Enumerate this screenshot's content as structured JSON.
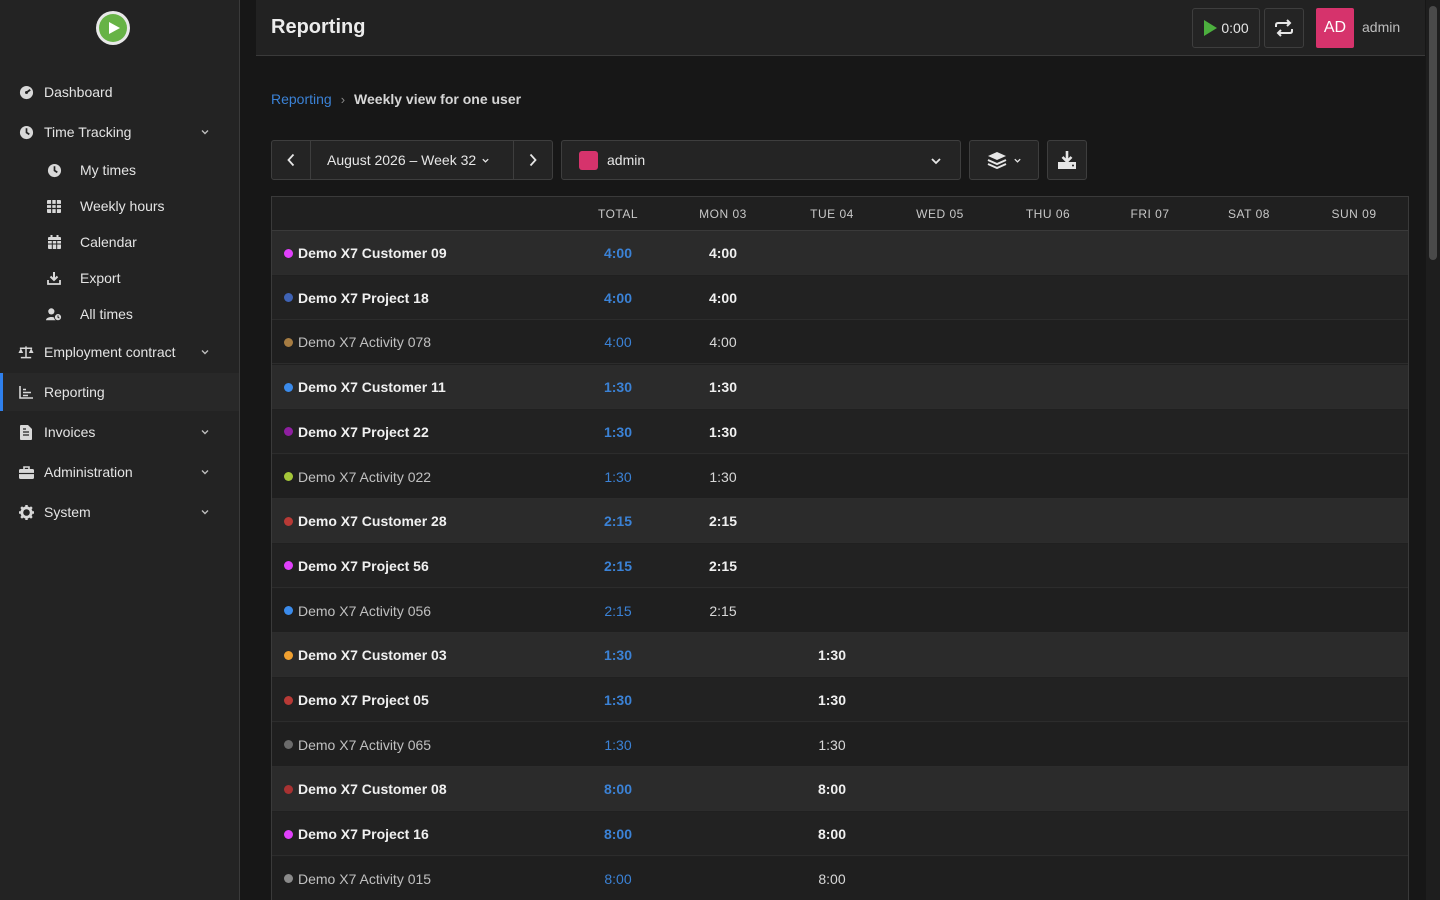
{
  "sidebar": {
    "items": [
      {
        "label": "Dashboard",
        "icon": "dashboard-icon"
      },
      {
        "label": "Time Tracking",
        "icon": "clock-icon",
        "expandable": true
      },
      {
        "label": "My times",
        "icon": "clock-icon",
        "sub": true
      },
      {
        "label": "Weekly hours",
        "icon": "table-icon",
        "sub": true
      },
      {
        "label": "Calendar",
        "icon": "calendar-icon",
        "sub": true
      },
      {
        "label": "Export",
        "icon": "download-icon",
        "sub": true
      },
      {
        "label": "All times",
        "icon": "users-clock-icon",
        "sub": true
      },
      {
        "label": "Employment contract",
        "icon": "scale-icon",
        "expandable": true
      },
      {
        "label": "Reporting",
        "icon": "chart-icon",
        "active": true
      },
      {
        "label": "Invoices",
        "icon": "invoice-icon",
        "expandable": true
      },
      {
        "label": "Administration",
        "icon": "briefcase-icon",
        "expandable": true
      },
      {
        "label": "System",
        "icon": "gear-icon",
        "expandable": true
      }
    ]
  },
  "header": {
    "title": "Reporting",
    "timer": "0:00",
    "avatar_initials": "AD",
    "username": "admin"
  },
  "breadcrumb": {
    "parent": "Reporting",
    "separator": "›",
    "current": "Weekly view for one user"
  },
  "toolbar": {
    "week": "August 2026 – Week 32",
    "user": "admin"
  },
  "colors": {
    "accent": "#2f80ed",
    "link": "#3b82d6",
    "avatar": "#d6336c",
    "play": "#67b346"
  },
  "table": {
    "columns": [
      "TOTAL",
      "MON 03",
      "TUE 04",
      "WED 05",
      "THU 06",
      "FRI 07",
      "SAT 08",
      "SUN 09"
    ],
    "rows": [
      {
        "type": "customer",
        "name": "Demo X7 Customer 09",
        "color": "#e040fb",
        "total": "4:00",
        "days": [
          "4:00",
          "",
          "",
          "",
          "",
          "",
          ""
        ]
      },
      {
        "type": "project",
        "name": "Demo X7 Project 18",
        "color": "#3f63b5",
        "total": "4:00",
        "days": [
          "4:00",
          "",
          "",
          "",
          "",
          "",
          ""
        ]
      },
      {
        "type": "activity",
        "name": "Demo X7 Activity 078",
        "color": "#a67c42",
        "total": "4:00",
        "days": [
          "4:00",
          "",
          "",
          "",
          "",
          "",
          ""
        ]
      },
      {
        "type": "customer",
        "name": "Demo X7 Customer 11",
        "color": "#3b8beb",
        "total": "1:30",
        "days": [
          "1:30",
          "",
          "",
          "",
          "",
          "",
          ""
        ]
      },
      {
        "type": "project",
        "name": "Demo X7 Project 22",
        "color": "#8e1fa0",
        "total": "1:30",
        "days": [
          "1:30",
          "",
          "",
          "",
          "",
          "",
          ""
        ]
      },
      {
        "type": "activity",
        "name": "Demo X7 Activity 022",
        "color": "#a4c639",
        "total": "1:30",
        "days": [
          "1:30",
          "",
          "",
          "",
          "",
          "",
          ""
        ]
      },
      {
        "type": "customer",
        "name": "Demo X7 Customer 28",
        "color": "#b83a36",
        "total": "2:15",
        "days": [
          "2:15",
          "",
          "",
          "",
          "",
          "",
          ""
        ]
      },
      {
        "type": "project",
        "name": "Demo X7 Project 56",
        "color": "#e040fb",
        "total": "2:15",
        "days": [
          "2:15",
          "",
          "",
          "",
          "",
          "",
          ""
        ]
      },
      {
        "type": "activity",
        "name": "Demo X7 Activity 056",
        "color": "#3b8beb",
        "total": "2:15",
        "days": [
          "2:15",
          "",
          "",
          "",
          "",
          "",
          ""
        ]
      },
      {
        "type": "customer",
        "name": "Demo X7 Customer 03",
        "color": "#f0a030",
        "total": "1:30",
        "days": [
          "",
          "1:30",
          "",
          "",
          "",
          "",
          ""
        ]
      },
      {
        "type": "project",
        "name": "Demo X7 Project 05",
        "color": "#b83a36",
        "total": "1:30",
        "days": [
          "",
          "1:30",
          "",
          "",
          "",
          "",
          ""
        ]
      },
      {
        "type": "activity",
        "name": "Demo X7 Activity 065",
        "color": "#6b6b6b",
        "total": "1:30",
        "days": [
          "",
          "1:30",
          "",
          "",
          "",
          "",
          ""
        ]
      },
      {
        "type": "customer",
        "name": "Demo X7 Customer 08",
        "color": "#a83232",
        "total": "8:00",
        "days": [
          "",
          "8:00",
          "",
          "",
          "",
          "",
          ""
        ]
      },
      {
        "type": "project",
        "name": "Demo X7 Project 16",
        "color": "#e040fb",
        "total": "8:00",
        "days": [
          "",
          "8:00",
          "",
          "",
          "",
          "",
          ""
        ]
      },
      {
        "type": "activity",
        "name": "Demo X7 Activity 015",
        "color": "#8a8a8a",
        "total": "8:00",
        "days": [
          "",
          "8:00",
          "",
          "",
          "",
          "",
          ""
        ]
      }
    ]
  }
}
